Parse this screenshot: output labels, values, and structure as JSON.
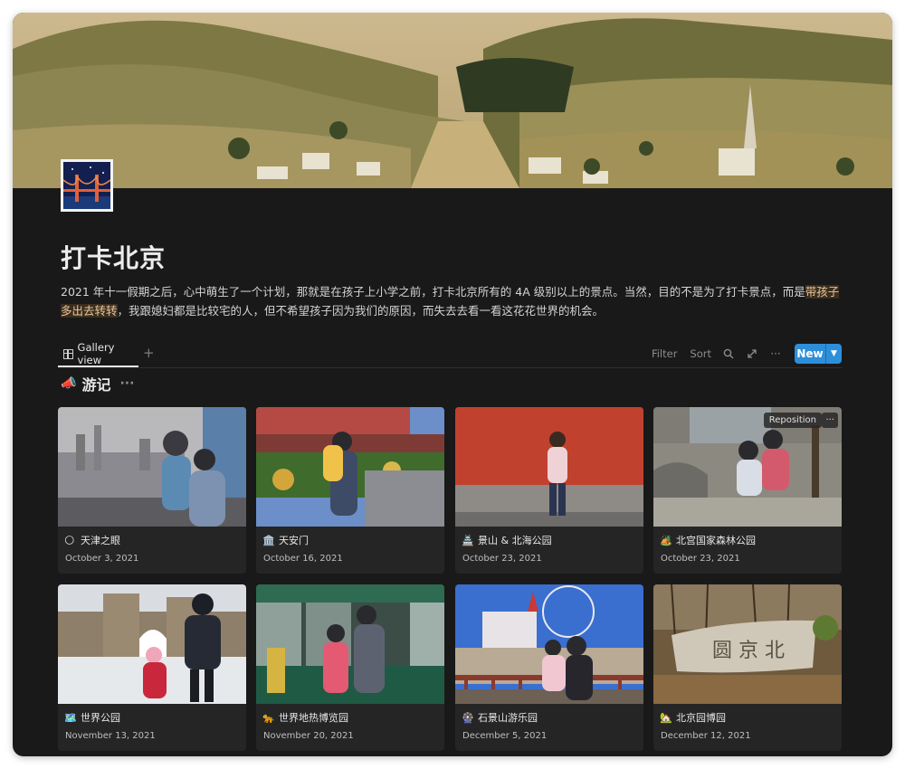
{
  "page": {
    "title": "打卡北京",
    "description_before": "2021 年十一假期之后，心中萌生了一个计划，那就是在孩子上小学之前，打卡北京所有的 4A 级别以上的景点。当然，目的不是为了打卡景点，而是",
    "description_highlight": "带孩子多出去转转",
    "description_after": "，我跟媳妇都是比较宅的人，但不希望孩子因为我们的原因，而失去去看一看这花花世界的机会。",
    "icon": "golden-gate-bridge-icon",
    "highlight_color": "#e8c79b"
  },
  "toolbar": {
    "view_tab": "Gallery view",
    "add_view": "+",
    "filter": "Filter",
    "sort": "Sort",
    "new_label": "New",
    "accent_color": "#2d8fd9"
  },
  "group": {
    "emoji": "📣",
    "title": "游记",
    "menu": "···"
  },
  "cover_menu": {
    "reposition": "Reposition",
    "more": "···"
  },
  "cards": [
    {
      "emoji": "🌕",
      "name": "天津之眼",
      "date": "October 3, 2021"
    },
    {
      "emoji": "🏛️",
      "name": "天安门",
      "date": "October 16, 2021"
    },
    {
      "emoji": "🏯",
      "name": "景山 & 北海公园",
      "date": "October 23, 2021"
    },
    {
      "emoji": "🏕️",
      "name": "北宫国家森林公园",
      "date": "October 23, 2021"
    },
    {
      "emoji": "🗺️",
      "name": "世界公园",
      "date": "November 13, 2021"
    },
    {
      "emoji": "🐆",
      "name": "世界地热博览园",
      "date": "November 20, 2021"
    },
    {
      "emoji": "🎡",
      "name": "石景山游乐园",
      "date": "December 5, 2021"
    },
    {
      "emoji": "🏡",
      "name": "北京园博园",
      "date": "December 12, 2021"
    }
  ]
}
